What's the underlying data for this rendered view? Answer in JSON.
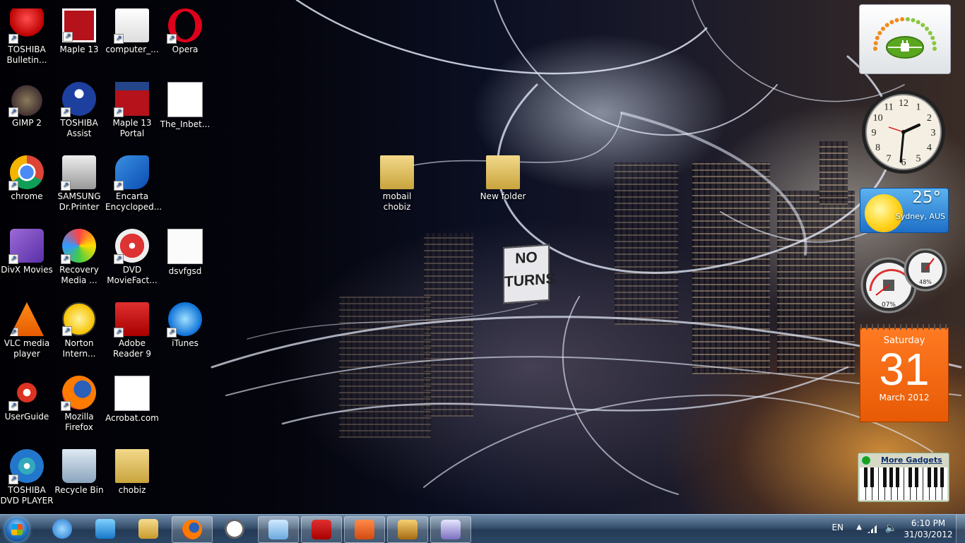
{
  "desktop": {
    "icons": [
      {
        "label": "TOSHIBA Bulletin...",
        "shortcut": true,
        "icon": "pushpin-icon"
      },
      {
        "label": "GIMP 2",
        "shortcut": true,
        "icon": "gimp-icon"
      },
      {
        "label": "chrome",
        "shortcut": true,
        "icon": "chrome-icon"
      },
      {
        "label": "DivX Movies",
        "shortcut": true,
        "icon": "divx-icon"
      },
      {
        "label": "VLC media player",
        "shortcut": true,
        "icon": "vlc-icon"
      },
      {
        "label": "UserGuide",
        "shortcut": true,
        "icon": "compass-icon"
      },
      {
        "label": "TOSHIBA DVD PLAYER",
        "shortcut": true,
        "icon": "dvd-icon"
      },
      {
        "label": "Maple 13",
        "shortcut": true,
        "icon": "maple-icon"
      },
      {
        "label": "TOSHIBA Assist",
        "shortcut": true,
        "icon": "assist-icon"
      },
      {
        "label": "SAMSUNG Dr.Printer",
        "shortcut": true,
        "icon": "printer-icon"
      },
      {
        "label": "Recovery Media ...",
        "shortcut": true,
        "icon": "recovery-disc-icon"
      },
      {
        "label": "Norton Intern...",
        "shortcut": true,
        "icon": "norton-globe-icon"
      },
      {
        "label": "Mozilla Firefox",
        "shortcut": true,
        "icon": "firefox-icon"
      },
      {
        "label": "Recycle Bin",
        "shortcut": false,
        "icon": "recycle-bin-icon"
      },
      {
        "label": "computer_...",
        "shortcut": true,
        "icon": "script-icon"
      },
      {
        "label": "Maple 13 Portal",
        "shortcut": true,
        "icon": "maple-portal-icon"
      },
      {
        "label": "Encarta Encycloped...",
        "shortcut": true,
        "icon": "encarta-icon"
      },
      {
        "label": "DVD MovieFact...",
        "shortcut": true,
        "icon": "dvd-moviefactory-icon"
      },
      {
        "label": "Adobe Reader 9",
        "shortcut": true,
        "icon": "adobe-reader-icon"
      },
      {
        "label": "Acrobat.com",
        "shortcut": false,
        "icon": "acrobat-icon"
      },
      {
        "label": "chobiz",
        "shortcut": false,
        "icon": "folder-icon"
      },
      {
        "label": "Opera",
        "shortcut": true,
        "icon": "opera-icon"
      },
      {
        "label": "The_Inbet...",
        "shortcut": false,
        "icon": "avi-file-icon"
      },
      {
        "label": "dsvfgsd",
        "shortcut": false,
        "icon": "text-file-icon"
      },
      {
        "label": "iTunes",
        "shortcut": true,
        "icon": "itunes-icon"
      },
      {
        "label": "mobail chobiz",
        "shortcut": false,
        "icon": "folder-icon"
      },
      {
        "label": "New folder",
        "shortcut": false,
        "icon": "folder-icon"
      }
    ],
    "wallpaper_sign": [
      "NO",
      "TURNS"
    ]
  },
  "gadgets": {
    "power": {
      "icon": "leaf-plug-icon"
    },
    "clock": {
      "icon": "analog-clock-icon",
      "numbers": [
        "12",
        "1",
        "2",
        "3",
        "4",
        "5",
        "6",
        "7",
        "8",
        "9",
        "10",
        "11"
      ]
    },
    "weather": {
      "temp": "25°",
      "city": "Sydney, AUS"
    },
    "cpu_meter": {
      "cpu": "07%",
      "memory": "48%"
    },
    "calendar": {
      "day": "Saturday",
      "date": "31",
      "month": "March 2012"
    },
    "more": {
      "label": "More Gadgets"
    }
  },
  "taskbar": {
    "pinned": [
      {
        "name": "ie",
        "icon": "internet-explorer-icon",
        "open": false
      },
      {
        "name": "media",
        "icon": "media-player-icon",
        "open": false
      },
      {
        "name": "explorer",
        "icon": "folders-icon",
        "open": false
      },
      {
        "name": "firefox",
        "icon": "firefox-icon",
        "open": true
      },
      {
        "name": "clock",
        "icon": "clock-icon",
        "open": false
      },
      {
        "name": "app1",
        "icon": "notepad-icon",
        "open": true
      },
      {
        "name": "adobe",
        "icon": "adobe-reader-icon",
        "open": true
      },
      {
        "name": "powerpoint",
        "icon": "powerpoint-icon",
        "open": true
      },
      {
        "name": "game",
        "icon": "king-card-icon",
        "open": true
      },
      {
        "name": "app2",
        "icon": "document-gift-icon",
        "open": true
      }
    ],
    "tray": {
      "lang": "EN",
      "time": "6:10 PM",
      "date": "31/03/2012"
    }
  },
  "colors": {
    "taskbar": "#2c4766",
    "calendar": "#f26b12",
    "weather": "#3a8fe0"
  }
}
